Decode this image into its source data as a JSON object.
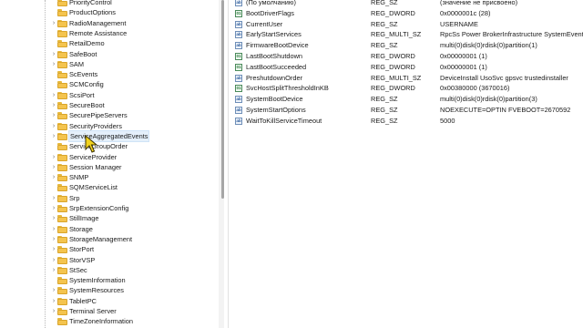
{
  "tree": {
    "items": [
      {
        "label": "PriorityControl",
        "expandable": false
      },
      {
        "label": "ProductOptions",
        "expandable": false
      },
      {
        "label": "RadioManagement",
        "expandable": true
      },
      {
        "label": "Remote Assistance",
        "expandable": false
      },
      {
        "label": "RetailDemo",
        "expandable": false
      },
      {
        "label": "SafeBoot",
        "expandable": true
      },
      {
        "label": "SAM",
        "expandable": true
      },
      {
        "label": "ScEvents",
        "expandable": false
      },
      {
        "label": "SCMConfig",
        "expandable": false
      },
      {
        "label": "ScsiPort",
        "expandable": true
      },
      {
        "label": "SecureBoot",
        "expandable": true
      },
      {
        "label": "SecurePipeServers",
        "expandable": true
      },
      {
        "label": "SecurityProviders",
        "expandable": true
      },
      {
        "label": "ServiceAggregatedEvents",
        "expandable": true
      },
      {
        "label": "ServiceGroupOrder",
        "expandable": false
      },
      {
        "label": "ServiceProvider",
        "expandable": true
      },
      {
        "label": "Session Manager",
        "expandable": true
      },
      {
        "label": "SNMP",
        "expandable": true
      },
      {
        "label": "SQMServiceList",
        "expandable": false
      },
      {
        "label": "Srp",
        "expandable": true
      },
      {
        "label": "SrpExtensionConfig",
        "expandable": true
      },
      {
        "label": "StillImage",
        "expandable": true
      },
      {
        "label": "Storage",
        "expandable": true
      },
      {
        "label": "StorageManagement",
        "expandable": true
      },
      {
        "label": "StorPort",
        "expandable": true
      },
      {
        "label": "StorVSP",
        "expandable": true
      },
      {
        "label": "StSec",
        "expandable": true
      },
      {
        "label": "SystemInformation",
        "expandable": false
      },
      {
        "label": "SystemResources",
        "expandable": true
      },
      {
        "label": "TabletPC",
        "expandable": true
      },
      {
        "label": "Terminal Server",
        "expandable": true
      },
      {
        "label": "TimeZoneInformation",
        "expandable": false
      }
    ]
  },
  "values": {
    "rows": [
      {
        "name": "(По умолчанию)",
        "type": "REG_SZ",
        "data": "(значение не присвоено)",
        "icon": "string-value-icon"
      },
      {
        "name": "BootDriverFlags",
        "type": "REG_DWORD",
        "data": "0x0000001c (28)",
        "icon": "binary-value-icon"
      },
      {
        "name": "CurrentUser",
        "type": "REG_SZ",
        "data": "USERNAME",
        "icon": "string-value-icon"
      },
      {
        "name": "EarlyStartServices",
        "type": "REG_MULTI_SZ",
        "data": "RpcSs Power BrokerInfrastructure SystemEvents",
        "icon": "string-value-icon"
      },
      {
        "name": "FirmwareBootDevice",
        "type": "REG_SZ",
        "data": "multi(0)disk(0)rdisk(0)partition(1)",
        "icon": "string-value-icon"
      },
      {
        "name": "LastBootShutdown",
        "type": "REG_DWORD",
        "data": "0x00000001 (1)",
        "icon": "binary-value-icon"
      },
      {
        "name": "LastBootSucceeded",
        "type": "REG_DWORD",
        "data": "0x00000001 (1)",
        "icon": "binary-value-icon"
      },
      {
        "name": "PreshutdownOrder",
        "type": "REG_MULTI_SZ",
        "data": "DeviceInstall UsoSvc gpsvc trustedinstaller",
        "icon": "string-value-icon"
      },
      {
        "name": "SvcHostSplitThresholdInKB",
        "type": "REG_DWORD",
        "data": "0x00380000 (3670016)",
        "icon": "binary-value-icon"
      },
      {
        "name": "SystemBootDevice",
        "type": "REG_SZ",
        "data": "multi(0)disk(0)rdisk(0)partition(3)",
        "icon": "string-value-icon"
      },
      {
        "name": "SystemStartOptions",
        "type": "REG_SZ",
        "data": " NOEXECUTE=OPTIN  FVEBOOT=2670592",
        "icon": "string-value-icon"
      },
      {
        "name": "WaitToKillServiceTimeout",
        "type": "REG_SZ",
        "data": "5000",
        "icon": "string-value-icon"
      }
    ]
  },
  "icons": {
    "folder": "folder-icon",
    "expand": "chevron-right-icon",
    "string_value": "ab",
    "binary_value": "01"
  },
  "colors": {
    "folder": "#f4c44e",
    "hover_highlight": "#e5f0fb"
  }
}
